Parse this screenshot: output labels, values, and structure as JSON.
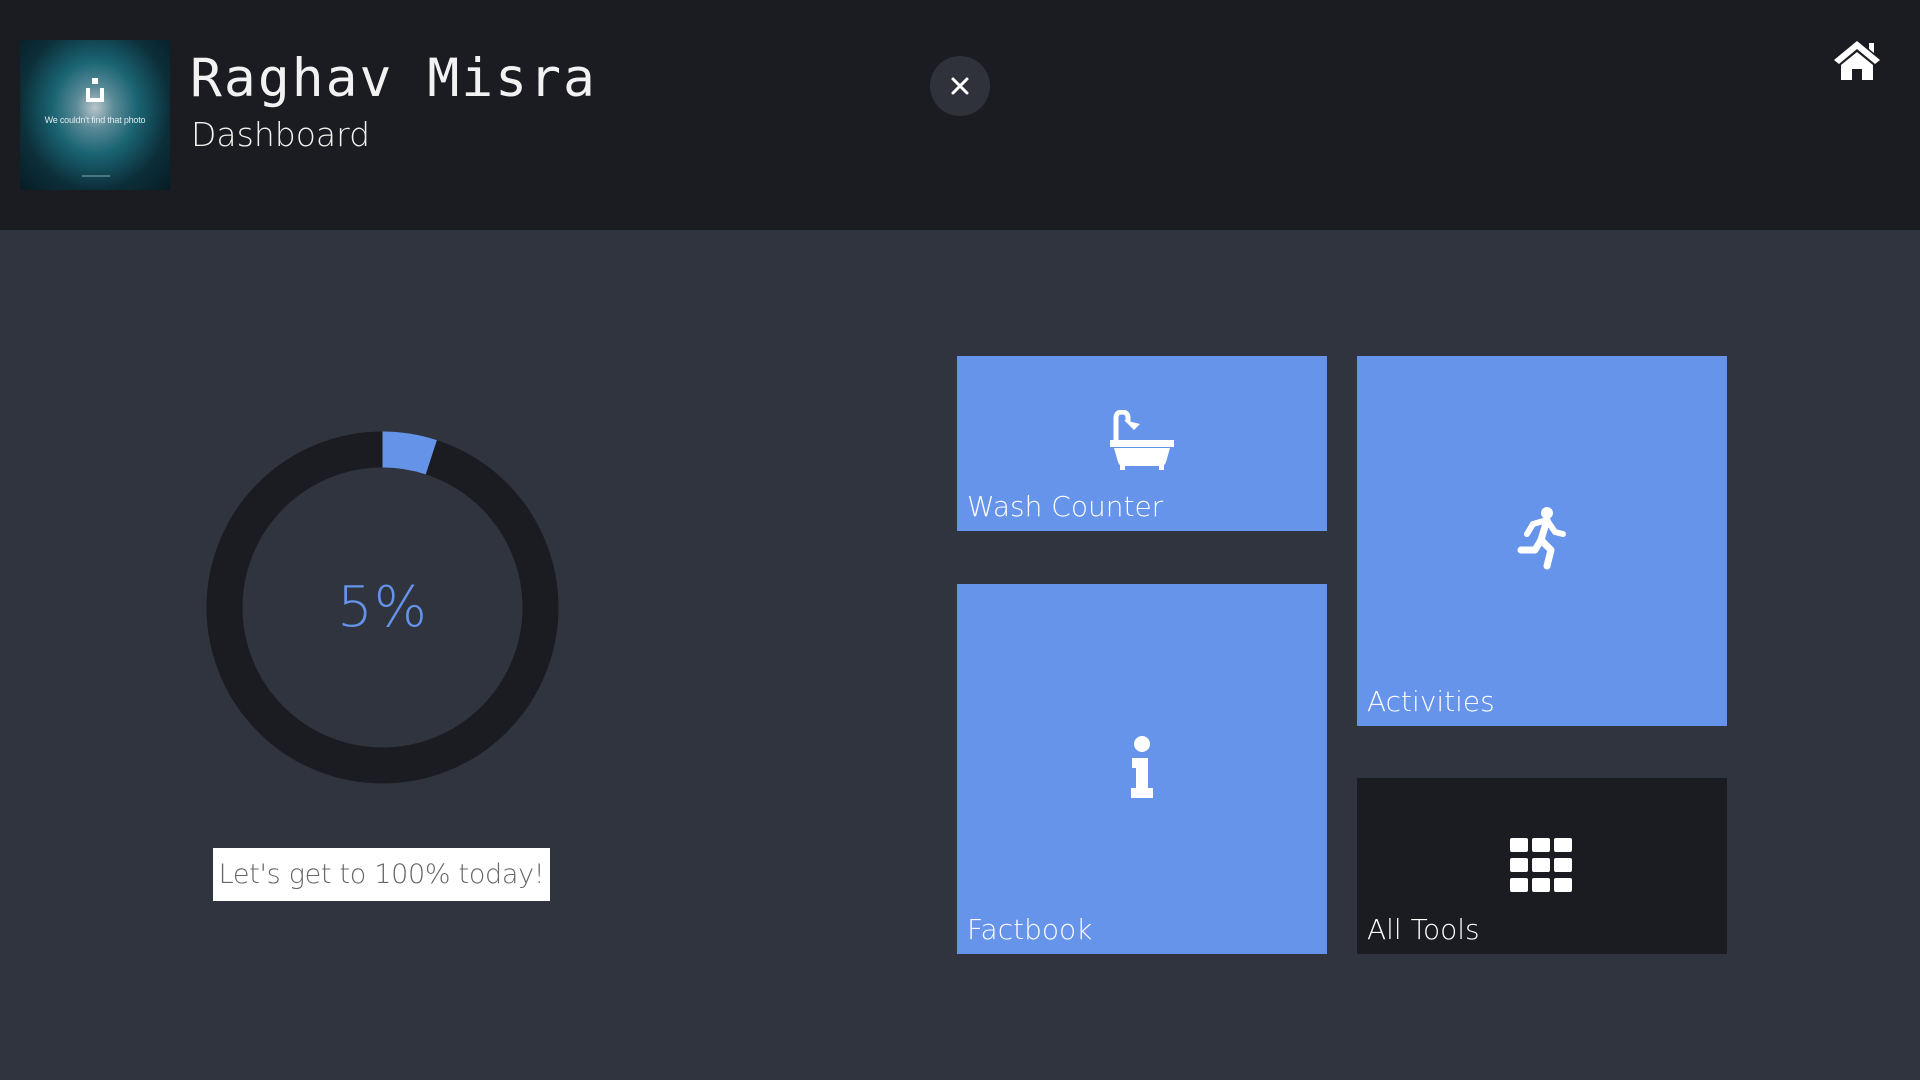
{
  "header": {
    "user_name": "Raghav Misra",
    "subtitle": "Dashboard",
    "avatar_placeholder_text": "We couldn't find that photo",
    "close_icon": "close-icon",
    "home_icon": "home-icon"
  },
  "progress": {
    "value_percent": 5,
    "label": "5%",
    "motivation": "Let's get to 100% today!",
    "track_color": "#1b1c21",
    "fill_color": "#6593e8"
  },
  "tiles": [
    {
      "label": "Wash Counter",
      "icon": "bathtub-icon",
      "color": "#6594ea"
    },
    {
      "label": "Activities",
      "icon": "running-person-icon",
      "color": "#6594ea"
    },
    {
      "label": "Factbook",
      "icon": "info-icon",
      "color": "#6594ea"
    },
    {
      "label": "All Tools",
      "icon": "grid-icon",
      "color": "#1b1c21"
    }
  ],
  "colors": {
    "background": "#30343f",
    "header_background": "#1b1c21",
    "accent": "#6594ea"
  }
}
